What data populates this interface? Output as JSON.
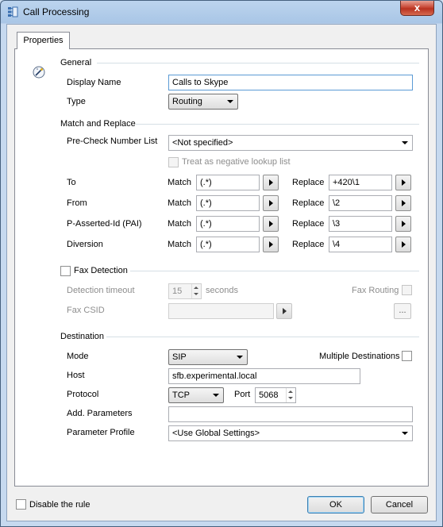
{
  "window": {
    "title": "Call Processing",
    "close_glyph": "x"
  },
  "tabs": [
    {
      "label": "Properties"
    }
  ],
  "general": {
    "section_label": "General",
    "display_name_label": "Display Name",
    "display_name_value": "Calls to Skype",
    "type_label": "Type",
    "type_value": "Routing"
  },
  "match_replace": {
    "section_label": "Match and Replace",
    "precheck_label": "Pre-Check Number List",
    "precheck_value": "<Not specified>",
    "negative_lookup_label": "Treat as negative lookup list",
    "match_label": "Match",
    "replace_label": "Replace",
    "rows": [
      {
        "label": "To",
        "match": "(.*)",
        "replace": "+420\\1"
      },
      {
        "label": "From",
        "match": "(.*)",
        "replace": "\\2"
      },
      {
        "label": "P-Asserted-Id (PAI)",
        "match": "(.*)",
        "replace": "\\3"
      },
      {
        "label": "Diversion",
        "match": "(.*)",
        "replace": "\\4"
      }
    ]
  },
  "fax": {
    "section_label": "Fax Detection",
    "timeout_label": "Detection timeout",
    "timeout_value": "15",
    "timeout_unit": "seconds",
    "routing_label": "Fax Routing",
    "csid_label": "Fax CSID",
    "csid_value": "",
    "ellipsis": "..."
  },
  "destination": {
    "section_label": "Destination",
    "mode_label": "Mode",
    "mode_value": "SIP",
    "multiple_label": "Multiple Destinations",
    "host_label": "Host",
    "host_value": "sfb.experimental.local",
    "protocol_label": "Protocol",
    "protocol_value": "TCP",
    "port_label": "Port",
    "port_value": "5068",
    "add_params_label": "Add. Parameters",
    "add_params_value": "",
    "param_profile_label": "Parameter Profile",
    "param_profile_value": "<Use Global Settings>"
  },
  "footer": {
    "disable_label": "Disable the rule",
    "ok_label": "OK",
    "cancel_label": "Cancel"
  }
}
